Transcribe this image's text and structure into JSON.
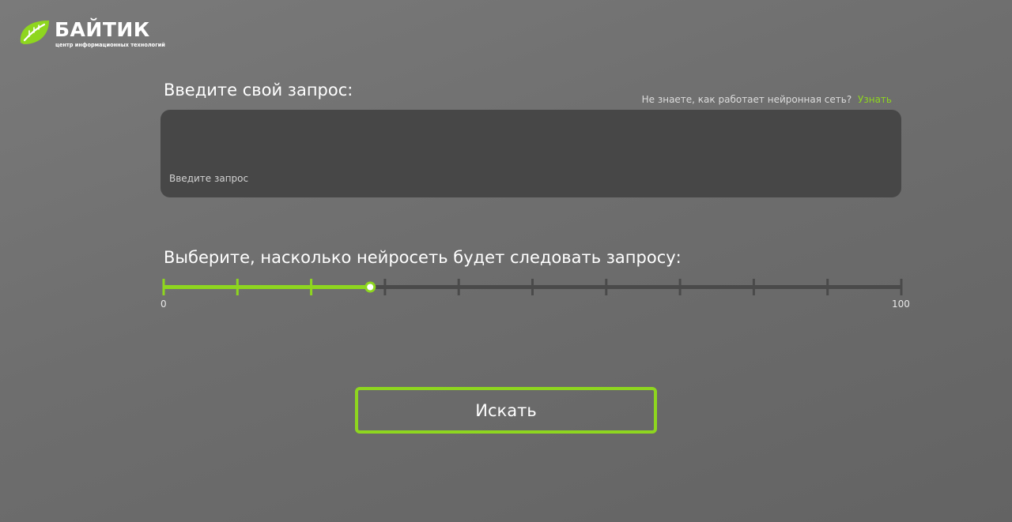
{
  "brand": {
    "name": "БАЙТИК",
    "tagline": "центр информационных технологий",
    "accent_color": "#8ed61f",
    "icon": "leaf-logo-icon"
  },
  "query": {
    "label": "Введите свой запрос:",
    "hint_text": "Не знаете, как работает нейронная сеть?",
    "hint_link": "Узнать",
    "placeholder": "Введите запрос",
    "value": ""
  },
  "slider": {
    "label": "Выберите, насколько нейросеть будет следовать запросу:",
    "min_label": "0",
    "max_label": "100",
    "min": 0,
    "max": 100,
    "value": 28,
    "tick_count": 11,
    "track_color": "#4a4a4a",
    "fill_color": "#8ed61f"
  },
  "search_button": {
    "label": "Искать"
  }
}
